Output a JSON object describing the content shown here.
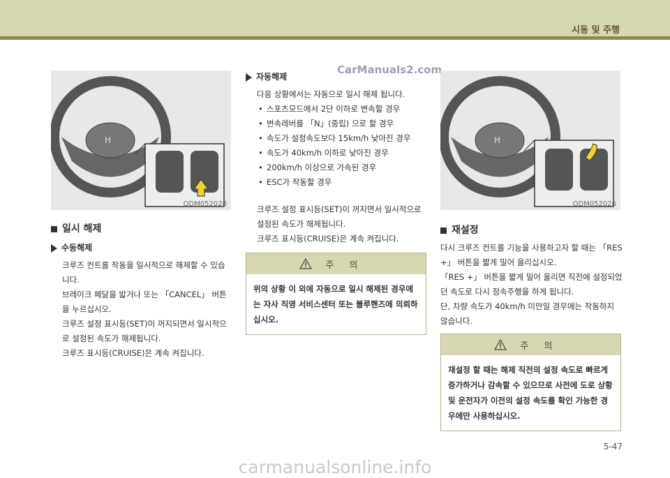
{
  "header": {
    "section_title": "시동 및 주행"
  },
  "watermark_top": "CarManuals2.com",
  "watermark_bottom": "carmanualsonline.info",
  "page_number": "5-47",
  "left": {
    "figure_code": "ODM052028",
    "heading": "일시 해제",
    "subheading": "수동해제",
    "paragraphs": [
      "크루즈 컨트롤 작동을 일시적으로 해제할 수 있습니다.",
      "브레이크 페달을 밟거나 또는 「CANCEL」 버튼을 누르십시오.",
      "크루즈 설정 표시등(SET)이 꺼지되면서 일시적으로 설정된 속도가 해제됩니다.",
      "크루즈 표시등(CRUISE)은 계속 켜집니다."
    ]
  },
  "middle": {
    "subheading": "자동해제",
    "intro": "다음 상황에서는 자동으로 일시 해제 됩니다.",
    "bullets": [
      "스포츠모드에서 2단 이하로 변속할 경우",
      "변속레버를 「N」(중립) 으로 할 경우",
      "속도가 설정속도보다 15km/h 낮아진 경우",
      "속도가 40km/h 이하로 낮아진 경우",
      "200km/h 이상으로 가속된 경우",
      "ESC가 작동할 경우"
    ],
    "paragraphs": [
      "크루즈 설정 표시등(SET)이 꺼지면서 일시적으로 설정된 속도가 해제됩니다.",
      "크루즈 표시등(CRUISE)은 계속 켜집니다."
    ],
    "caution_title": "주의",
    "caution_text": "위의 상황 이 외에 자동으로 일시 해제된 경우에는 자사 직영 서비스센터 또는 블루핸즈에 의뢰하십시오."
  },
  "right": {
    "figure_code": "ODM052026",
    "heading": "재설정",
    "paragraphs": [
      "다시 크루즈 컨트롤 기능을 사용하고자 할 때는 「RES +」 버튼을 짧게 밀어 올리십시오.",
      "「RES +」 버튼을 짧게 밀어 올리면 직전에 설정되었던 속도로 다시 정속주행을 하게 됩니다.",
      "단, 차량 속도가 40km/h 미만일 경우에는 작동하지 않습니다."
    ],
    "caution_title": "주의",
    "caution_text": "재설정 할 때는 해제 직전의 설정 속도로 빠르게 증가하거나 감속할 수 있으므로 사전에 도로 상황 및 운전자가 이전의 설정 속도를 확인 가능한 경우에만 사용하십시오."
  },
  "colors": {
    "header_bg": "#d8d7b3",
    "header_line": "#8d8a47",
    "arrow_highlight": "#f2d03a"
  }
}
